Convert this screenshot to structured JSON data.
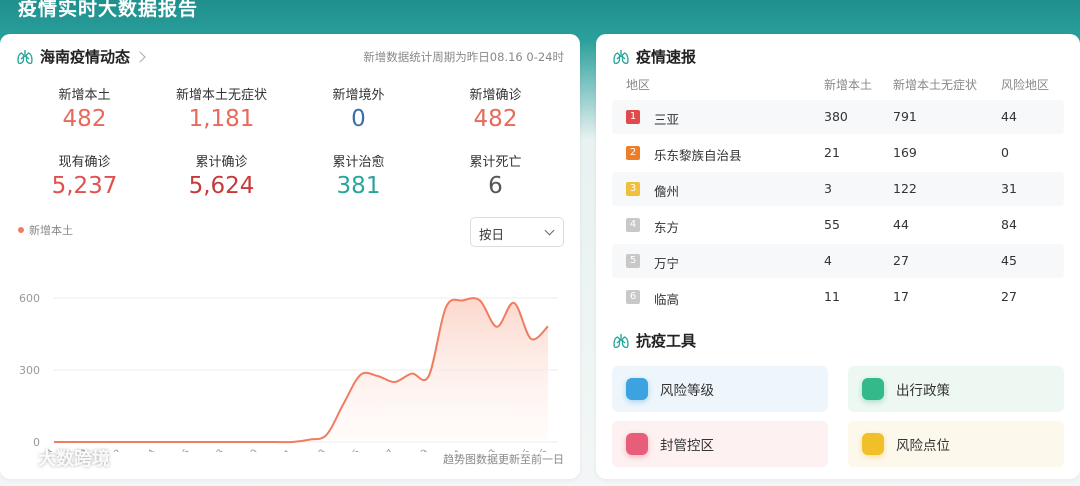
{
  "banner": {
    "title": "疫情实时大数据报告"
  },
  "left_card": {
    "title": "海南疫情动态",
    "period": "新增数据统计周期为昨日08.16 0-24时",
    "stats": [
      {
        "label": "新增本土",
        "value": "482",
        "color": "#e96a5a"
      },
      {
        "label": "新增本土无症状",
        "value": "1,181",
        "color": "#e96a5a"
      },
      {
        "label": "新增境外",
        "value": "0",
        "color": "#3a6fa8"
      },
      {
        "label": "新增确诊",
        "value": "482",
        "color": "#e96a5a"
      },
      {
        "label": "现有确诊",
        "value": "5,237",
        "color": "#e05050"
      },
      {
        "label": "累计确诊",
        "value": "5,624",
        "color": "#c83a3a"
      },
      {
        "label": "累计治愈",
        "value": "381",
        "color": "#2aa59b"
      },
      {
        "label": "累计死亡",
        "value": "6",
        "color": "#555555"
      }
    ],
    "legend": "新增本土",
    "dropdown": "按日",
    "footnote": "趋势图数据更新至前一日",
    "watermark": "大数跨境"
  },
  "chart_data": {
    "type": "area",
    "series": [
      {
        "name": "新增本土",
        "color": "#ee7d62"
      }
    ],
    "ylim": [
      0,
      600
    ],
    "yticks": [
      "600",
      "300",
      "0"
    ],
    "xticks": [
      "7.18",
      "7.20",
      "7.22",
      "7.24",
      "7.26",
      "7.28",
      "7.30",
      "8.1",
      "8.3",
      "8.5",
      "8.7",
      "8.9",
      "8.11",
      "8.13",
      "8.15",
      "8.16"
    ],
    "points": [
      [
        "7.18",
        0
      ],
      [
        "7.19",
        0
      ],
      [
        "7.20",
        0
      ],
      [
        "7.21",
        0
      ],
      [
        "7.22",
        0
      ],
      [
        "7.23",
        0
      ],
      [
        "7.24",
        0
      ],
      [
        "7.25",
        0
      ],
      [
        "7.26",
        0
      ],
      [
        "7.27",
        0
      ],
      [
        "7.28",
        0
      ],
      [
        "7.29",
        0
      ],
      [
        "7.30",
        0
      ],
      [
        "7.31",
        0
      ],
      [
        "8.1",
        0
      ],
      [
        "8.2",
        10
      ],
      [
        "8.3",
        30
      ],
      [
        "8.4",
        160
      ],
      [
        "8.5",
        280
      ],
      [
        "8.6",
        275
      ],
      [
        "8.7",
        250
      ],
      [
        "8.8",
        285
      ],
      [
        "8.9",
        275
      ],
      [
        "8.10",
        560
      ],
      [
        "8.11",
        590
      ],
      [
        "8.12",
        590
      ],
      [
        "8.13",
        480
      ],
      [
        "8.14",
        580
      ],
      [
        "8.15",
        430
      ],
      [
        "8.16",
        482
      ]
    ]
  },
  "right_card": {
    "title": "疫情速报",
    "columns": [
      "地区",
      "新增本土",
      "新增本土无症状",
      "风险地区"
    ],
    "rows": [
      {
        "rank": "1",
        "rank_color": "#e04a4a",
        "region": "三亚",
        "local": "380",
        "asym": "791",
        "risk": "44"
      },
      {
        "rank": "2",
        "rank_color": "#ee7d2a",
        "region": "乐东黎族自治县",
        "local": "21",
        "asym": "169",
        "risk": "0"
      },
      {
        "rank": "3",
        "rank_color": "#f2bf3a",
        "region": "儋州",
        "local": "3",
        "asym": "122",
        "risk": "31"
      },
      {
        "rank": "4",
        "rank_color": "#c8c8c8",
        "region": "东方",
        "local": "55",
        "asym": "44",
        "risk": "84"
      },
      {
        "rank": "5",
        "rank_color": "#c8c8c8",
        "region": "万宁",
        "local": "4",
        "asym": "27",
        "risk": "45"
      },
      {
        "rank": "6",
        "rank_color": "#c8c8c8",
        "region": "临高",
        "local": "11",
        "asym": "17",
        "risk": "27"
      }
    ],
    "tools_title": "抗疫工具",
    "tools": [
      {
        "label": "风险等级",
        "icon": "risk-level-icon",
        "bg": "#eef6fb",
        "icon_color": "#3aa3e0"
      },
      {
        "label": "出行政策",
        "icon": "car-icon",
        "bg": "#eef8f3",
        "icon_color": "#34b98a"
      },
      {
        "label": "封管控区",
        "icon": "lockdown-zone-icon",
        "bg": "#fdf1f1",
        "icon_color": "#e85e7a"
      },
      {
        "label": "风险点位",
        "icon": "risk-point-icon",
        "bg": "#fdf8ec",
        "icon_color": "#f0bf2a"
      }
    ]
  }
}
